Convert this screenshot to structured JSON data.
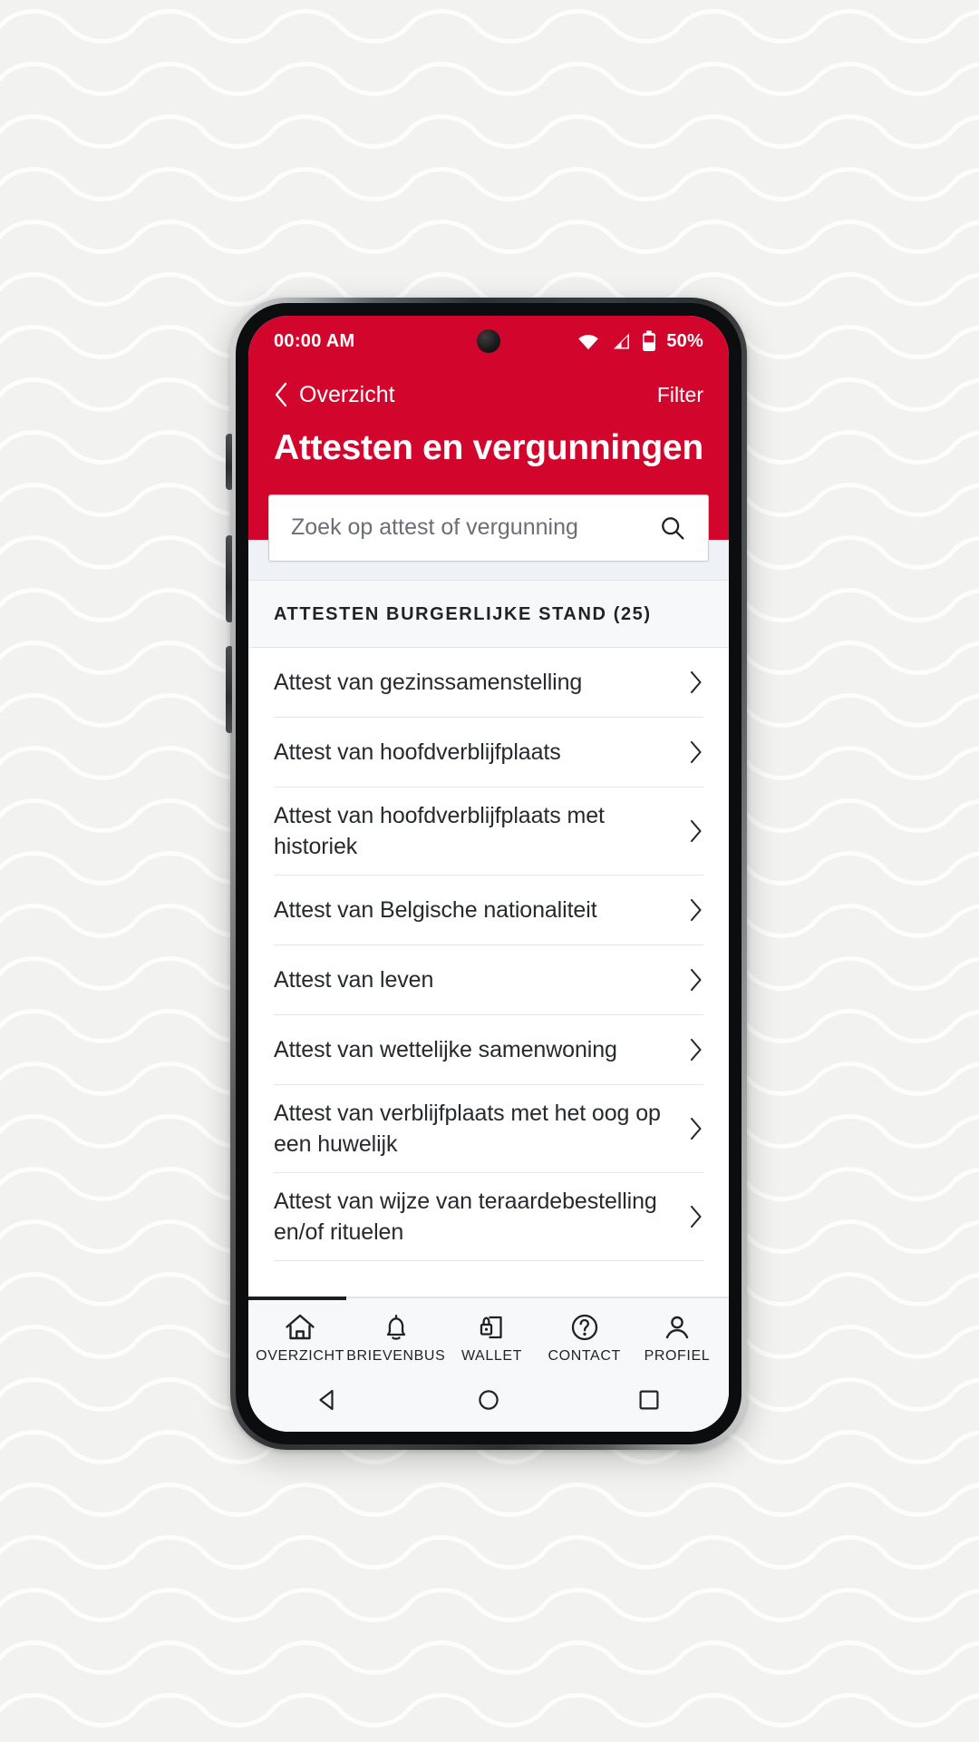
{
  "status_bar": {
    "time": "00:00 AM",
    "battery_percent": "50%",
    "icons": [
      "wifi-icon",
      "cellular-signal-icon",
      "battery-icon"
    ]
  },
  "header": {
    "back_label": "Overzicht",
    "back_icon": "chevron-left-icon",
    "filter_label": "Filter",
    "title": "Attesten en vergunningen",
    "background_color": "#d2062c"
  },
  "search": {
    "value": "",
    "placeholder": "Zoek op attest of vergunning",
    "icon": "search-icon"
  },
  "section": {
    "title": "ATTESTEN BURGERLIJKE STAND (25)"
  },
  "list": {
    "items": [
      {
        "label": "Attest van gezinssamenstelling"
      },
      {
        "label": "Attest van hoofdverblijfplaats"
      },
      {
        "label": "Attest van hoofdverblijfplaats met historiek"
      },
      {
        "label": "Attest van Belgische nationaliteit"
      },
      {
        "label": "Attest van leven"
      },
      {
        "label": "Attest van wettelijke samenwoning"
      },
      {
        "label": "Attest van verblijfplaats met het oog op een huwelijk"
      },
      {
        "label": "Attest van wijze van teraardebestelling en/of rituelen"
      }
    ],
    "chevron_icon": "chevron-right-icon"
  },
  "bottom_nav": {
    "items": [
      {
        "label": "OVERZICHT",
        "icon": "home-icon",
        "active": true
      },
      {
        "label": "BRIEVENBUS",
        "icon": "bell-icon",
        "active": false
      },
      {
        "label": "WALLET",
        "icon": "wallet-lock-icon",
        "active": false
      },
      {
        "label": "CONTACT",
        "icon": "question-circle-icon",
        "active": false
      },
      {
        "label": "PROFIEL",
        "icon": "person-icon",
        "active": false
      }
    ]
  },
  "system_bar": {
    "back": "triangle-back-icon",
    "home": "circle-home-icon",
    "recents": "square-recents-icon"
  }
}
